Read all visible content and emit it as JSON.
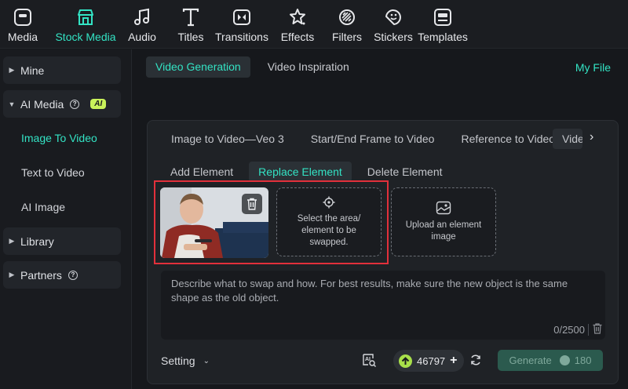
{
  "colors": {
    "accent": "#33e3c4",
    "highlight": "#e2303b",
    "ai_badge": "#c9f25a",
    "generate_bg": "#2b5a4e"
  },
  "toolbar": {
    "items": [
      {
        "label": "Media",
        "icon": "media-icon",
        "active": false
      },
      {
        "label": "Stock Media",
        "icon": "stock-media-icon",
        "active": true
      },
      {
        "label": "Audio",
        "icon": "music-note-icon",
        "active": false
      },
      {
        "label": "Titles",
        "icon": "text-t-icon",
        "active": false
      },
      {
        "label": "Transitions",
        "icon": "transitions-icon",
        "active": false
      },
      {
        "label": "Effects",
        "icon": "effects-star-icon",
        "active": false
      },
      {
        "label": "Filters",
        "icon": "filters-icon",
        "active": false
      },
      {
        "label": "Stickers",
        "icon": "sticker-icon",
        "active": false
      },
      {
        "label": "Templates",
        "icon": "templates-icon",
        "active": false
      }
    ]
  },
  "sidebar": {
    "mine": "Mine",
    "ai_media": "AI Media",
    "ai_badge": "AI",
    "items": [
      "Image To Video",
      "Text to Video",
      "AI Image"
    ],
    "library": "Library",
    "partners": "Partners"
  },
  "main": {
    "tabs": [
      "Video Generation",
      "Video Inspiration"
    ],
    "my_file": "My File"
  },
  "panel": {
    "sub_tabs": [
      "Image to Video—Veo 3",
      "Start/End Frame to Video",
      "Reference to Video",
      "Video"
    ],
    "mode_tabs": [
      "Add Element",
      "Replace Element",
      "Delete Element"
    ],
    "select_area_text": "Select the area/ element to be swapped.",
    "upload_text": "Upload an element image",
    "prompt_placeholder": "Describe what to swap and how. For best results, make sure the new object is the same shape as the old object.",
    "char_count": "0/2500",
    "setting_label": "Setting",
    "credits": "46797",
    "generate_label": "Generate",
    "generate_cost": "180"
  }
}
